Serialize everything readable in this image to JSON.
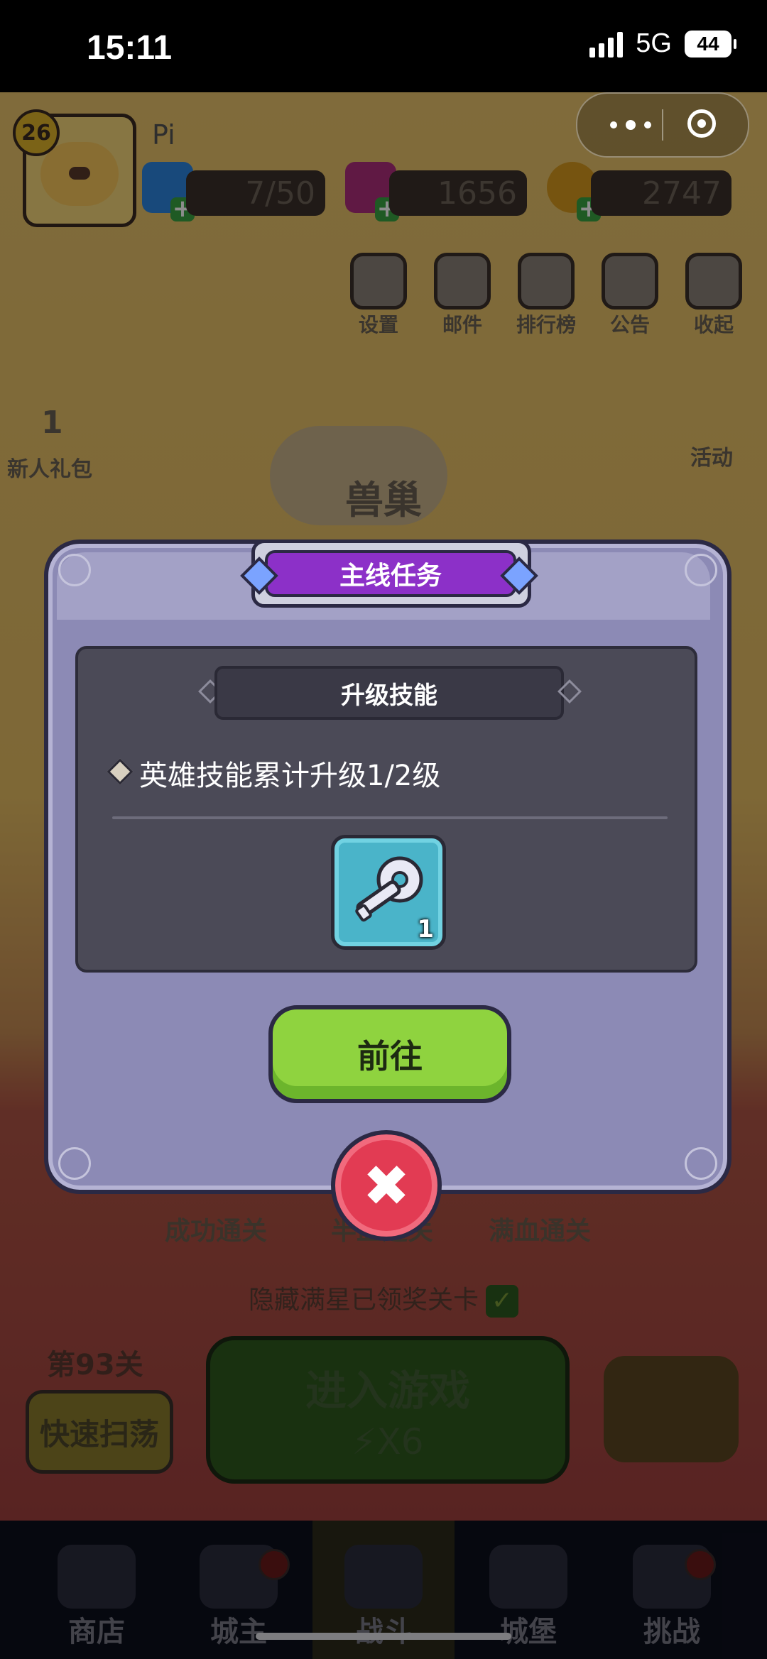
{
  "status_bar": {
    "time": "15:11",
    "network": "5G",
    "battery": "44"
  },
  "player": {
    "level": "26",
    "name": "Pi"
  },
  "resources": {
    "energy": "7/50",
    "gems": "1656",
    "coins": "2747"
  },
  "top_menu": [
    "设置",
    "邮件",
    "排行榜",
    "公告",
    "收起"
  ],
  "side_left": {
    "newbie_pack": "新人礼包",
    "newbie_num": "1"
  },
  "side_right": {
    "activity": "活动"
  },
  "area_title": "兽巢",
  "result_labels": [
    "成功通关",
    "半血通关",
    "满血通关"
  ],
  "hidden_star_text": "隐藏满星已领奖关卡",
  "stage": "第93关",
  "quick_sweep": "快速扫荡",
  "enter_game": {
    "label": "进入游戏",
    "cost": "X6"
  },
  "bottom_nav": [
    "商店",
    "城主",
    "战斗",
    "城堡",
    "挑战"
  ],
  "modal": {
    "title": "主线任务",
    "subtitle": "升级技能",
    "task": "英雄技能累计升级1/2级",
    "reward_count": "1",
    "go_button": "前往",
    "close_icon": "close-icon"
  },
  "colors": {
    "modal_bg": "#8c8ab5",
    "title_purple": "#8c30c8",
    "go_green": "#8fd33f",
    "close_red": "#e23b53"
  }
}
